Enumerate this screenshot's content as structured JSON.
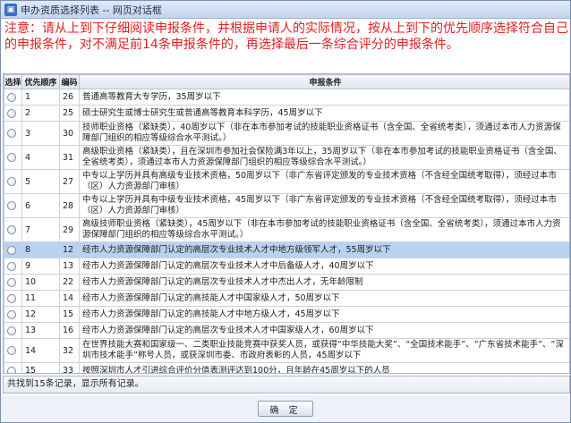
{
  "window": {
    "title": "申办资质选择列表 -- 网页对话框"
  },
  "notice": "注意：请从上到下仔细阅读申报条件，并根据申请人的实际情况，按从上到下的优先顺序选择符合自己的申报条件，对不满足前14条申报条件的，再选择最后一条综合评分的申报条件。",
  "table": {
    "headers": [
      "选择",
      "优先顺序",
      "编码",
      "申报条件"
    ],
    "rows": [
      {
        "priority": "1",
        "code": "26",
        "condition": "普通高等教育大专学历，35周岁以下"
      },
      {
        "priority": "2",
        "code": "25",
        "condition": "硕士研究生或博士研究生或普通高等教育本科学历，45周岁以下"
      },
      {
        "priority": "3",
        "code": "30",
        "condition": "技师职业资格（紧缺类），40周岁以下（非在本市参加考试的技能职业资格证书（含全国、全省统考类），须通过本市人力资源保障部门组织的相应等级综合水平测试。）"
      },
      {
        "priority": "4",
        "code": "31",
        "condition": "高级职业资格（紧缺类），且在深圳市参加社会保险满3年以上，35周岁以下（非在本市参加考试的技能职业资格证书（含全国、全省统考类），须通过本市人力资源保障部门组织的相应等级综合水平测试。）"
      },
      {
        "priority": "5",
        "code": "27",
        "condition": "中专以上学历并具有高级专业技术资格，50周岁以下（非广东省评定颁发的专业技术资格（不含经全国统考取得），须经过本市（区）人力资源部门审核）"
      },
      {
        "priority": "6",
        "code": "28",
        "condition": "中专以上学历并具有中级专业技术资格，45周岁以下（非广东省评定颁发的专业技术资格（不含经全国统考取得），须经过本市（区）人力资源部门审核）"
      },
      {
        "priority": "7",
        "code": "29",
        "condition": "高级技师职业资格（紧缺类），45周岁以下（非在本市参加考试的技能职业资格证书（含全国、全省统考类），须通过本市人力资源保障部门组织的相应等级综合水平测试。）"
      },
      {
        "priority": "8",
        "code": "12",
        "condition": "经市人力资源保障部门认定的高层次专业技术人才中地方级领军人才，55周岁以下"
      },
      {
        "priority": "9",
        "code": "13",
        "condition": "经市人力资源保障部门认定的高层次专业技术人才中后备级人才，40周岁以下"
      },
      {
        "priority": "10",
        "code": "22",
        "condition": "经市人力资源保障部门认定的高层次专业技术人才中杰出人才，无年龄限制"
      },
      {
        "priority": "11",
        "code": "14",
        "condition": "经市人力资源保障部门认定的高技能人才中国家级人才，50周岁以下"
      },
      {
        "priority": "12",
        "code": "15",
        "condition": "经市人力资源保障部门认定的高技能人才中地方级人才，45周岁以下"
      },
      {
        "priority": "13",
        "code": "16",
        "condition": "经市人力资源保障部门认定的高层次专业技术人才中国家级人才，60周岁以下"
      },
      {
        "priority": "14",
        "code": "32",
        "condition": "在世界技能大赛和国家级一、二类职业技能竞赛中获奖人员，或获得“中华技能大奖”、“全国技术能手”、“广东省技术能手”、“深圳市技术能手”称号人员，或获深圳市委、市政府表彰的人员，45周岁以下"
      },
      {
        "priority": "15",
        "code": "33",
        "condition": "按照深圳市人才引进综合评价分值表测评达到100分，且年龄在45周岁以下的人员"
      }
    ]
  },
  "status": "共找到15条记录，显示所有记录。",
  "buttons": {
    "confirm": "确 定"
  }
}
